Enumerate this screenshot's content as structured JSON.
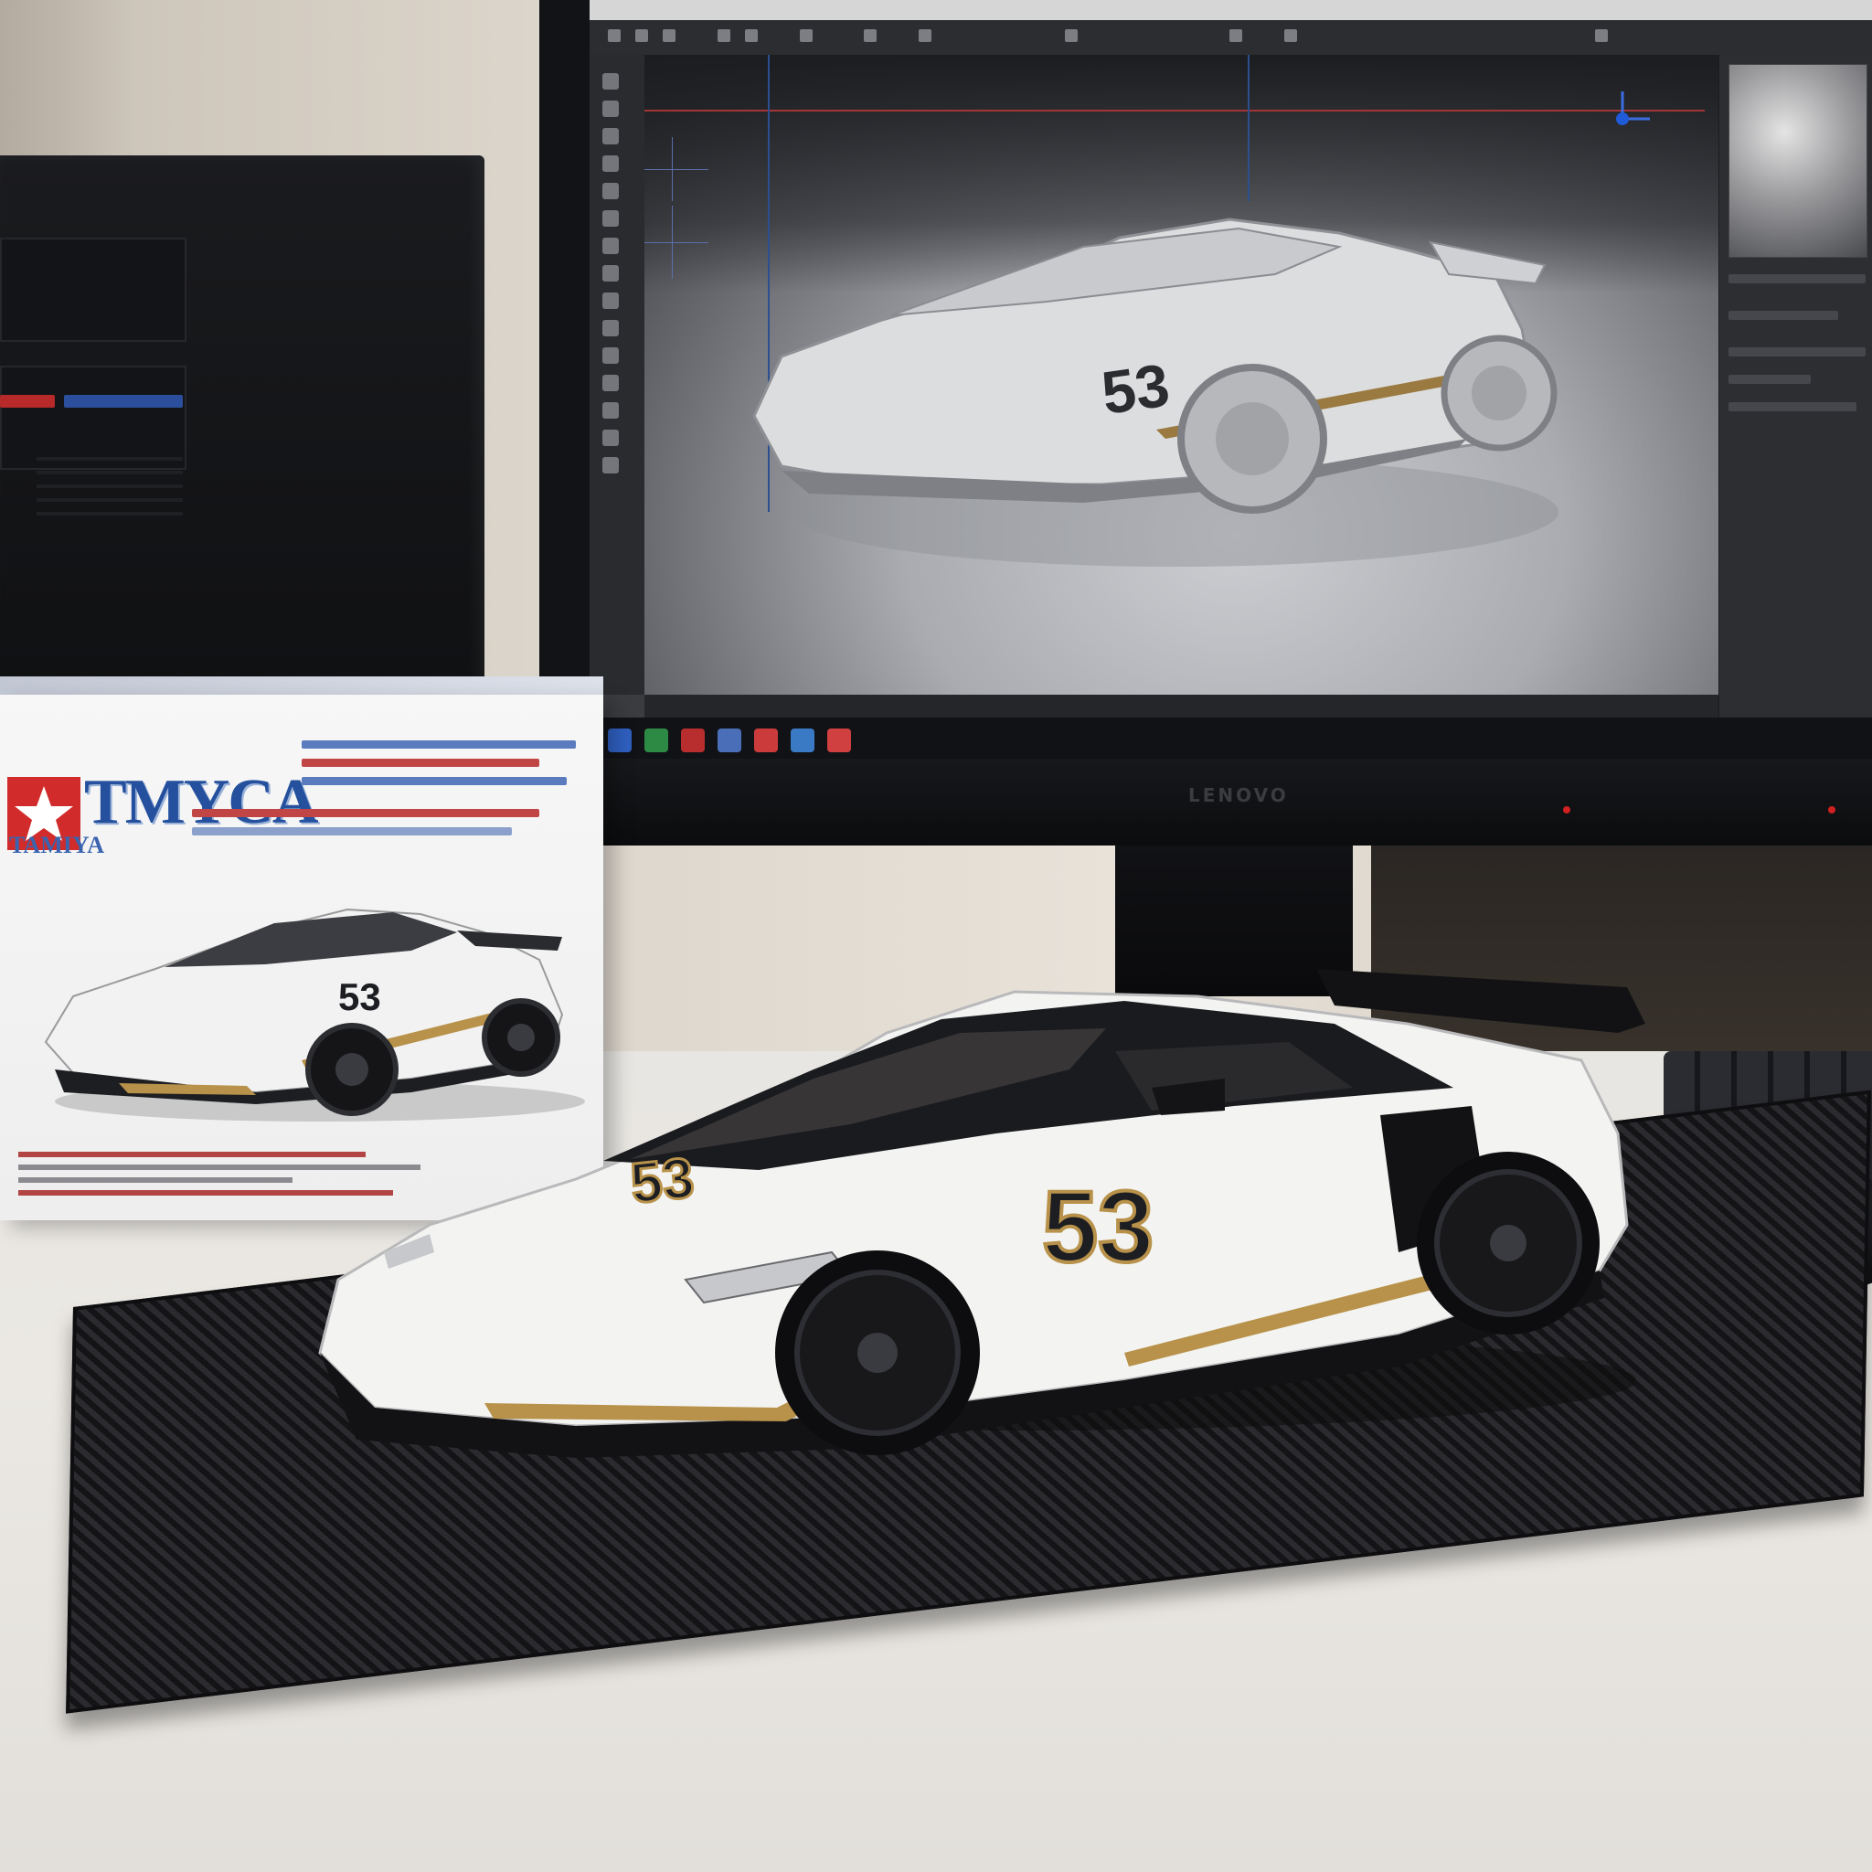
{
  "scene": {
    "description_free": true
  },
  "box": {
    "brand": "TMYCA",
    "sub_brand": "TAMIYA",
    "car_number": "53"
  },
  "car": {
    "number": "53"
  },
  "screen_car": {
    "number": "53"
  },
  "monitor": {
    "logo": "LENOVO"
  },
  "colors": {
    "car_body": "#f3f3f1",
    "car_black": "#121214",
    "accent_gold": "#b8924a",
    "box_blue": "#24509e",
    "box_red": "#d12b2b",
    "carbon_base": "#1b1b1d"
  },
  "icons": [
    "star-logo-icon",
    "axis-gizmo-icon",
    "taskbar-app-icons"
  ]
}
